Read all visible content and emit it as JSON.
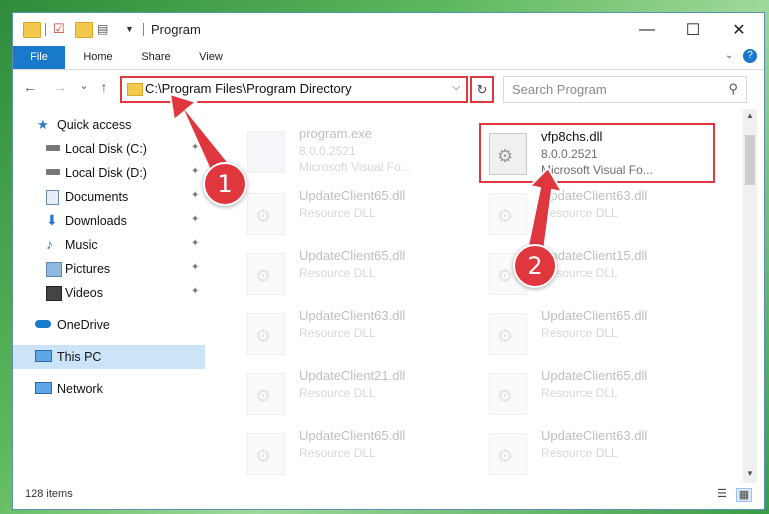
{
  "window": {
    "title": "Program",
    "controls": {
      "minimize": "—",
      "maximize": "☐",
      "close": "✕"
    }
  },
  "ribbon": {
    "tabs": [
      "File",
      "Home",
      "Share",
      "View"
    ]
  },
  "address": {
    "path": "C:\\Program Files\\Program Directory",
    "refresh_icon": "↻",
    "chevron": "⌵"
  },
  "search": {
    "placeholder": "Search Program",
    "icon": "⚲"
  },
  "nav": {
    "back": "←",
    "forward": "→",
    "recent": "⌄",
    "up": "↑"
  },
  "sidebar": {
    "items": [
      {
        "label": "Quick access",
        "icon": "star-icon"
      },
      {
        "label": "Local Disk (C:)",
        "icon": "drive-icon",
        "pinned": true
      },
      {
        "label": "Local Disk (D:)",
        "icon": "drive-icon",
        "pinned": true
      },
      {
        "label": "Documents",
        "icon": "documents-icon",
        "pinned": true
      },
      {
        "label": "Downloads",
        "icon": "download-icon",
        "pinned": true
      },
      {
        "label": "Music",
        "icon": "music-icon",
        "pinned": true
      },
      {
        "label": "Pictures",
        "icon": "pictures-icon",
        "pinned": true
      },
      {
        "label": "Videos",
        "icon": "videos-icon",
        "pinned": true
      },
      {
        "label": "OneDrive",
        "icon": "cloud-icon"
      },
      {
        "label": "This PC",
        "icon": "computer-icon",
        "selected": true
      },
      {
        "label": "Network",
        "icon": "network-icon"
      }
    ],
    "pin_glyph": "📌"
  },
  "files": [
    {
      "name": "program.exe",
      "line2": "8.0.0.2521",
      "line3": "Microsoft Visual Fo..."
    },
    {
      "name": "vfp8chs.dll",
      "line2": "8.0.0.2521",
      "line3": "Microsoft Visual Fo..."
    },
    {
      "name": "UpdateClient65.dll",
      "line2": "Resource DLL"
    },
    {
      "name": "UpdateClient63.dll",
      "line2": "Resource DLL"
    },
    {
      "name": "UpdateClient65.dll",
      "line2": "Resource DLL"
    },
    {
      "name": "UpdateClient15.dll",
      "line2": "Resource DLL"
    },
    {
      "name": "UpdateClient63.dll",
      "line2": "Resource DLL"
    },
    {
      "name": "UpdateClient65.dll",
      "line2": "Resource DLL"
    },
    {
      "name": "UpdateClient21.dll",
      "line2": "Resource DLL"
    },
    {
      "name": "UpdateClient65.dll",
      "line2": "Resource DLL"
    },
    {
      "name": "UpdateClient65.dll",
      "line2": "Resource DLL"
    },
    {
      "name": "UpdateClient63.dll",
      "line2": "Resource DLL"
    }
  ],
  "status": {
    "items": "128 items",
    "details_icon": "☰",
    "tiles_icon": "▦"
  },
  "annotations": {
    "step1": "1",
    "step2": "2",
    "color": "#e0363e"
  },
  "colors": {
    "accent": "#1979ca",
    "highlight": "#e0363e",
    "selected": "#cce4f7"
  }
}
